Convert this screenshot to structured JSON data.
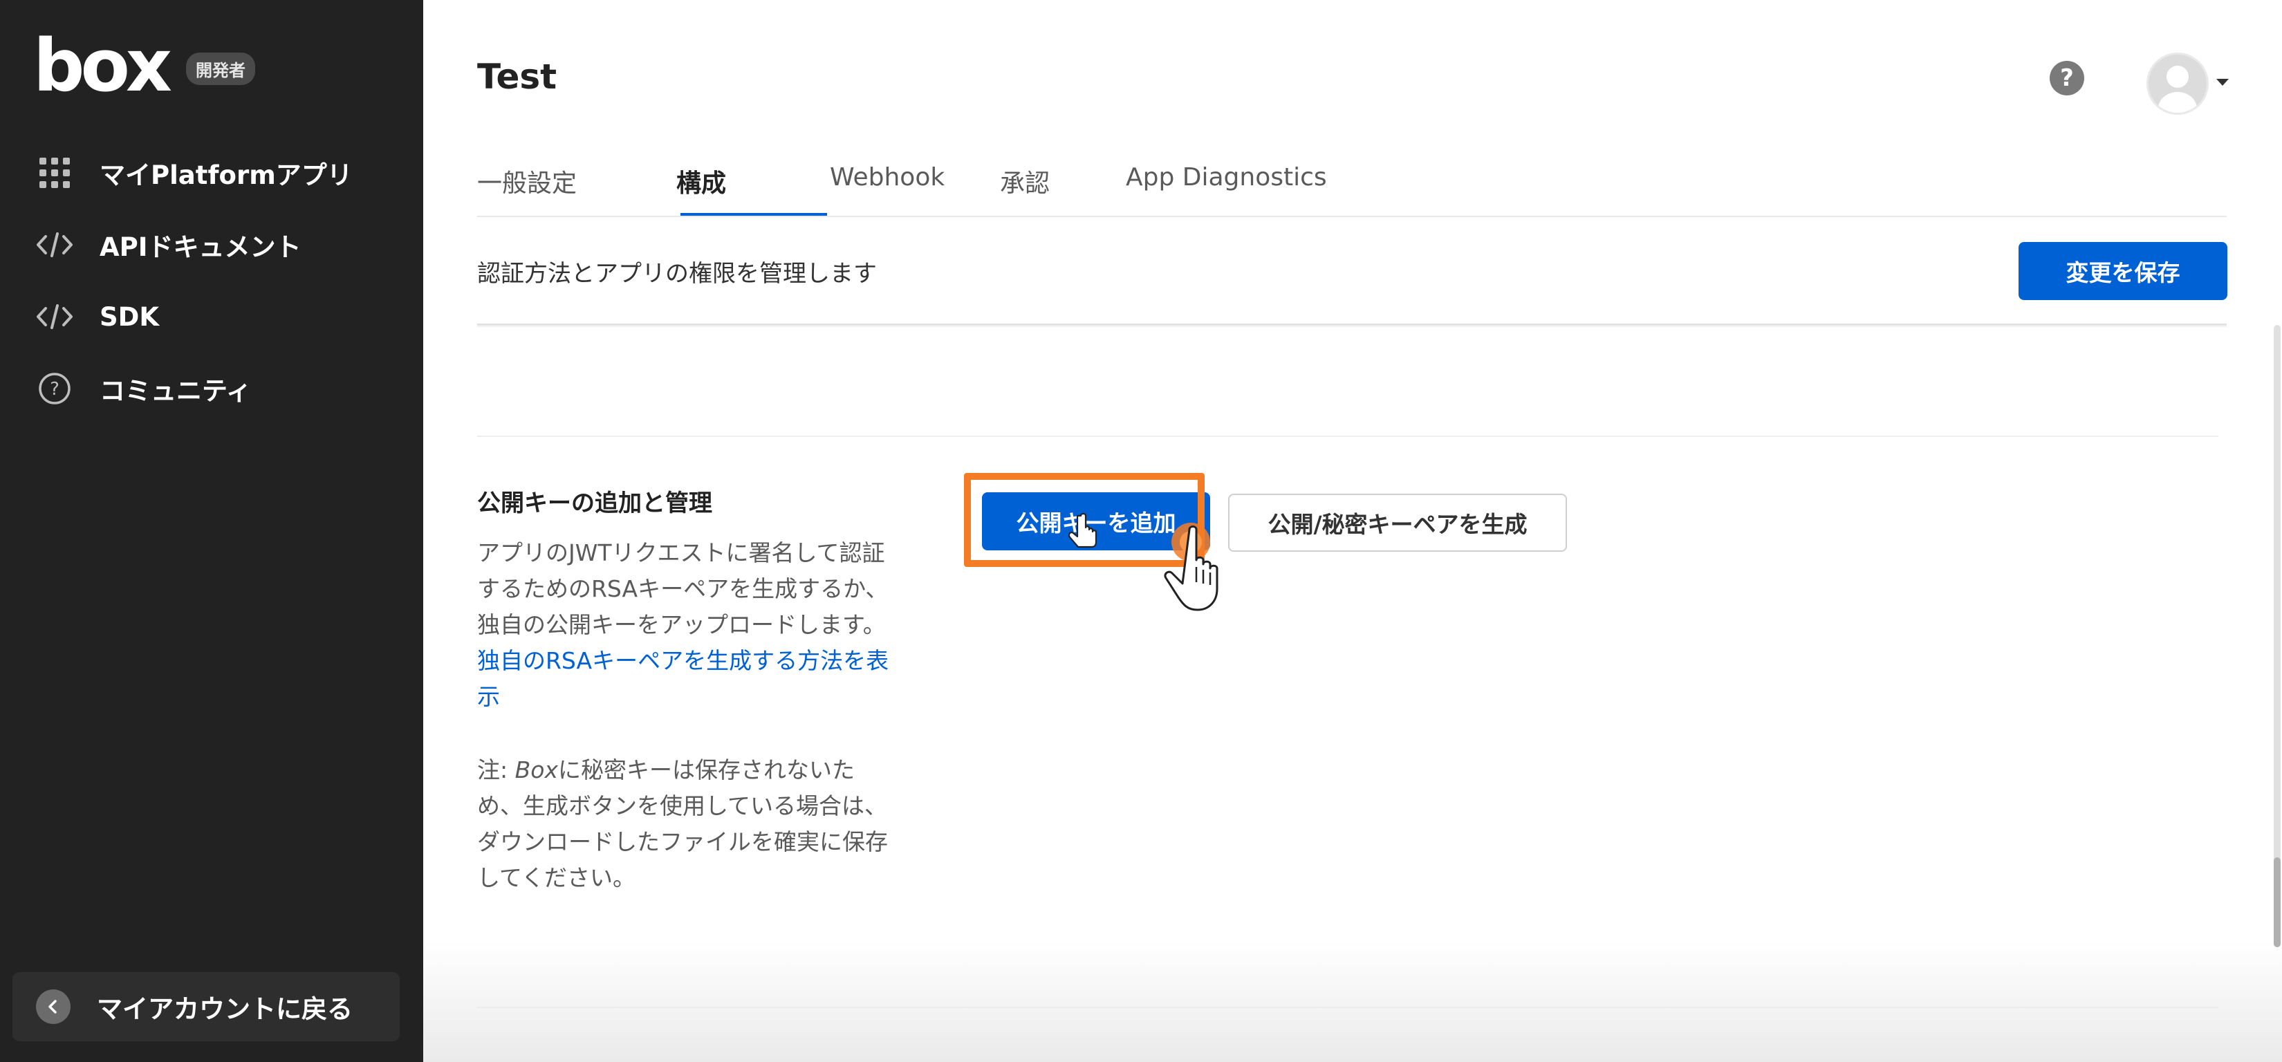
{
  "sidebar": {
    "brand": "box",
    "badge": "開発者",
    "items": [
      {
        "label": "マイPlatformアプリ",
        "icon": "grid-icon"
      },
      {
        "label": "APIドキュメント",
        "icon": "code-icon"
      },
      {
        "label": "SDK",
        "icon": "code-icon"
      },
      {
        "label": "コミュニティ",
        "icon": "help-circle-icon"
      }
    ],
    "back_label": "マイアカウントに戻る"
  },
  "header": {
    "title": "Test",
    "help_symbol": "?"
  },
  "tabs": [
    {
      "label": "一般設定",
      "active": false
    },
    {
      "label": "構成",
      "active": true
    },
    {
      "label": "Webhook",
      "active": false
    },
    {
      "label": "承認",
      "active": false
    },
    {
      "label": "App Diagnostics",
      "active": false
    }
  ],
  "page": {
    "subtitle": "認証方法とアプリの権限を管理します",
    "save_label": "変更を保存"
  },
  "public_key_section": {
    "title": "公開キーの追加と管理",
    "description": "アプリのJWTリクエストに署名して認証するためのRSAキーペアを生成するか、独自の公開キーをアップロードします。",
    "link_text": "独自のRSAキーペアを生成する方法を表示",
    "note_prefix": "注: ",
    "note_italic": "Box",
    "note_rest": "に秘密キーは保存されないため、生成ボタンを使用している場合は、ダウンロードしたファイルを確実に保存してください。",
    "add_key_label": "公開キーを追加",
    "generate_label": "公開/秘密キーペアを生成"
  },
  "colors": {
    "sidebar_bg": "#222222",
    "accent": "#0061d5",
    "highlight": "#f57c26"
  }
}
